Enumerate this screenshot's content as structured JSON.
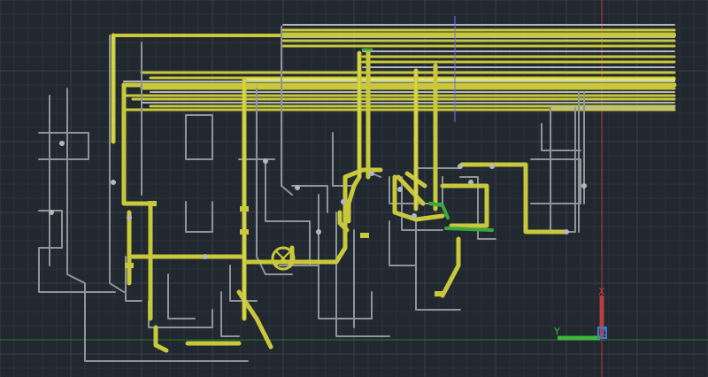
{
  "canvas": {
    "background": "#212830",
    "grid_minor_color": "#2a323c",
    "grid_major_color": "#36404c",
    "x_axis_color": "#1e7d2c",
    "y_axis_color": "#c03a36"
  },
  "colors": {
    "pipe_yellow": "#c8c83a",
    "pipe_yellow_light": "#e6e660",
    "pipe_grey": "#8e949a",
    "pipe_grey_light": "#b4b8bc",
    "pipe_green": "#3aa83a",
    "crosshair": "#6f6ff0"
  },
  "ucs_icon": {
    "x_label": "X",
    "y_label": "Y",
    "z_label": "Z",
    "x_color": "#b84040",
    "y_color": "#3cb83c",
    "z_color": "#3c7ad8"
  }
}
